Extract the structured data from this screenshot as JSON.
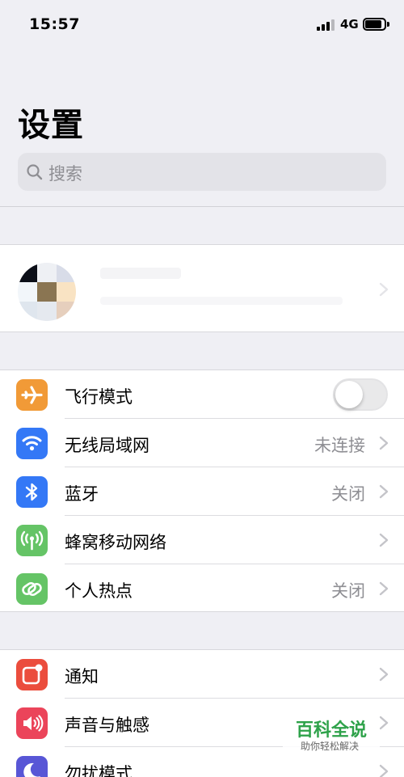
{
  "status_bar": {
    "time": "15:57",
    "network": "4G",
    "signal_bars": 4,
    "signal_bars_active": 3
  },
  "header": {
    "title": "设置",
    "search_placeholder": "搜索"
  },
  "colors": {
    "airplane": "#f19a37",
    "wifi": "#3478f6",
    "bluetooth": "#3478f6",
    "cellular": "#65c466",
    "hotspot": "#65c466",
    "notifications": "#eb4d3d",
    "sounds": "#eb445a",
    "dnd": "#5856d6",
    "watermark": "#2ea24a"
  },
  "network_group": [
    {
      "id": "airplane",
      "label": "飞行模式",
      "icon": "airplane-icon",
      "toggle": false
    },
    {
      "id": "wifi",
      "label": "无线局域网",
      "value": "未连接",
      "icon": "wifi-icon"
    },
    {
      "id": "bluetooth",
      "label": "蓝牙",
      "value": "关闭",
      "icon": "bluetooth-icon"
    },
    {
      "id": "cellular",
      "label": "蜂窝移动网络",
      "value": "",
      "icon": "antenna-icon"
    },
    {
      "id": "hotspot",
      "label": "个人热点",
      "value": "关闭",
      "icon": "link-icon"
    }
  ],
  "notification_group": [
    {
      "id": "notifications",
      "label": "通知",
      "icon": "notification-icon"
    },
    {
      "id": "sounds",
      "label": "声音与触感",
      "icon": "speaker-icon"
    },
    {
      "id": "dnd",
      "label": "勿扰模式",
      "icon": "moon-icon"
    }
  ],
  "watermark": {
    "title": "百科全说",
    "subtitle": "助你轻松解决"
  }
}
